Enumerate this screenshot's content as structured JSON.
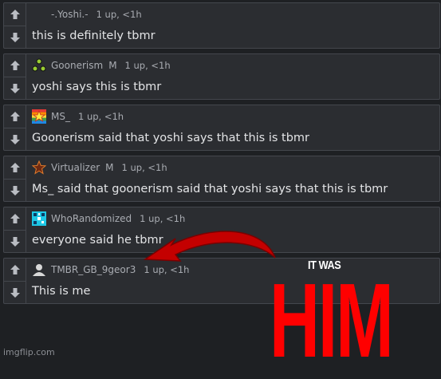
{
  "comments": [
    {
      "user": "-.Yoshi.-",
      "mod": "",
      "stats": "1 up, <1h",
      "badge": "none-icon",
      "text": "this is definitely tbmr"
    },
    {
      "user": "Goonerism",
      "mod": "M",
      "stats": "1 up, <1h",
      "badge": "triangle-dots-icon",
      "text": "yoshi says this is tbmr"
    },
    {
      "user": "MS_",
      "mod": "",
      "stats": "1 up, <1h",
      "badge": "rainbow-star-icon",
      "text": "Goonerism said that yoshi says that this is tbmr"
    },
    {
      "user": "Virtualizer",
      "mod": "M",
      "stats": "1 up, <1h",
      "badge": "dark-star-icon",
      "text": "Ms_ said that goonerism said that yoshi says that this is tbmr"
    },
    {
      "user": "WhoRandomized",
      "mod": "",
      "stats": "1 up, <1h",
      "badge": "qr-pattern-icon",
      "text": "everyone said he tbmr"
    },
    {
      "user": "TMBR_GB_9geor3",
      "mod": "",
      "stats": "1 up, <1h",
      "badge": "user-silhouette-icon",
      "text": "This is me"
    }
  ],
  "overlay": {
    "caption_small": "IT WAS",
    "caption_big": "HIM",
    "arrow_color": "#cc0000"
  },
  "footer": {
    "brand": "imgflip.com"
  },
  "colors": {
    "panel": "#2b2d31",
    "border": "#44474d",
    "text": "#e3e4e6",
    "meta": "#a9acb2",
    "accent_red": "#ff0000"
  }
}
